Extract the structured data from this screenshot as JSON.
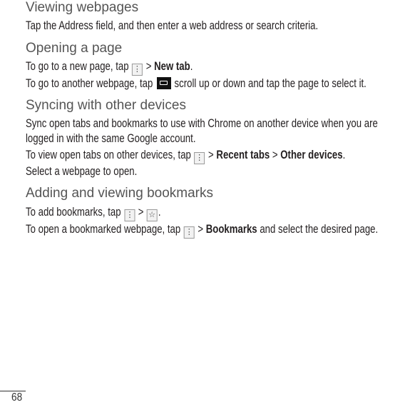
{
  "sections": [
    {
      "heading": "Viewing webpages"
    },
    {
      "heading": "Opening a page"
    },
    {
      "heading": "Syncing with other devices"
    },
    {
      "heading": "Adding and viewing bookmarks"
    }
  ],
  "lines": {
    "l1": "Tap the Address field, and then enter a web address or search criteria.",
    "l2a": "To go to a new page, tap",
    "l2b": "New tab",
    "l3a": "To go to another webpage, tap",
    "l3b": ", scroll up or down and tap the page to select it.",
    "l4": "Sync open tabs and bookmarks to use with Chrome on another device when you are",
    "l5": "logged in with the same Google account.",
    "l6a": "To view open tabs on other devices, tap",
    "l6b": "Recent tabs",
    "l6c": "Other devices",
    "l7": "Select a webpage to open.",
    "l8a": "To add bookmarks, tap",
    "l9a": "To open a bookmarked webpage, tap",
    "l9b": "Bookmarks",
    "l9c": " and select the desired page."
  },
  "symbols": {
    "gt": " > ",
    "period": ".",
    "menu": "⋮",
    "star": "☆"
  },
  "page_number": "68"
}
